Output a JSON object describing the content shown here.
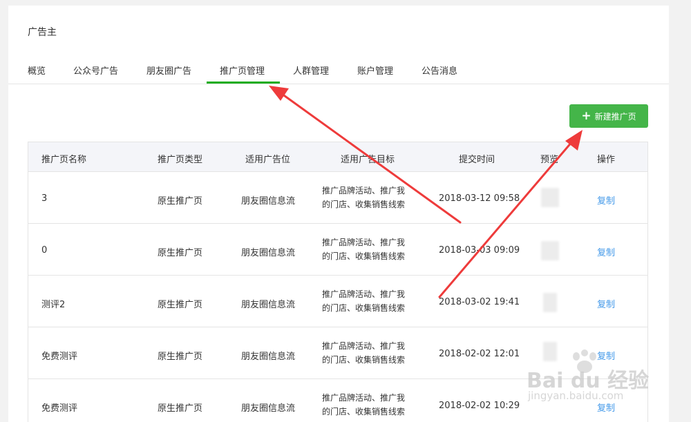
{
  "app_title": "广告主",
  "tabs": [
    {
      "label": "概览"
    },
    {
      "label": "公众号广告"
    },
    {
      "label": "朋友圈广告"
    },
    {
      "label": "推广页管理"
    },
    {
      "label": "人群管理"
    },
    {
      "label": "账户管理"
    },
    {
      "label": "公告消息"
    }
  ],
  "active_tab": "推广页管理",
  "new_button": {
    "icon": "plus-icon",
    "label": "新建推广页"
  },
  "table": {
    "headers": [
      "推广页名称",
      "推广页类型",
      "适用广告位",
      "适用广告目标",
      "提交时间",
      "预览",
      "操作"
    ],
    "rows": [
      {
        "name": "3",
        "type": "原生推广页",
        "placement": "朋友圈信息流",
        "target_line1": "推广品牌活动、推广我",
        "target_line2": "的门店、收集销售线索",
        "time": "2018-03-12 09:58",
        "action": "复制"
      },
      {
        "name": "0",
        "type": "原生推广页",
        "placement": "朋友圈信息流",
        "target_line1": "推广品牌活动、推广我",
        "target_line2": "的门店、收集销售线索",
        "time": "2018-03-03 09:09",
        "action": "复制"
      },
      {
        "name": "测评2",
        "type": "原生推广页",
        "placement": "朋友圈信息流",
        "target_line1": "推广品牌活动、推广我",
        "target_line2": "的门店、收集销售线索",
        "time": "2018-03-02 19:41",
        "action": "复制"
      },
      {
        "name": "免费测评",
        "type": "原生推广页",
        "placement": "朋友圈信息流",
        "target_line1": "推广品牌活动、推广我",
        "target_line2": "的门店、收集销售线索",
        "time": "2018-02-02 12:01",
        "action": "复制"
      },
      {
        "name": "免费测评",
        "type": "原生推广页",
        "placement": "朋友圈信息流",
        "target_line1": "推广品牌活动、推广我",
        "target_line2": "的门店、收集销售线索",
        "time": "2018-02-02 10:29",
        "action": "复制"
      }
    ]
  },
  "watermark": {
    "logo": "Bai du 经验",
    "url": "jingyan.baidu.com"
  },
  "colors": {
    "accent": "#1aad19",
    "button": "#44b549",
    "link": "#459ae9",
    "arrow": "#ee3b3b"
  }
}
